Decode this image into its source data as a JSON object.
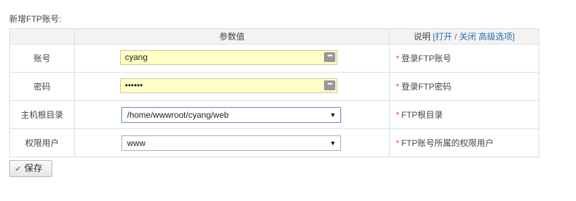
{
  "page": {
    "title": "新增FTP账号:"
  },
  "table": {
    "headers": {
      "param_value": "参数值",
      "note_prefix": "说明",
      "toggle_links": "[打开 / 关闭 高级选项]"
    }
  },
  "rows": [
    {
      "label": "账号",
      "value": "cyang",
      "note": "登录FTP账号"
    },
    {
      "label": "密码",
      "value": "••••••",
      "note": "登录FTP密码"
    },
    {
      "label": "主机根目录",
      "value": "/home/wwwroot/cyang/web",
      "note": "FTP根目录"
    },
    {
      "label": "权限用户",
      "value": "www",
      "note": "FTP账号所属的权限用户"
    }
  ],
  "required_marker": "*",
  "password_button_glyph": "•••",
  "save": {
    "label": "保存",
    "icon": "check-icon"
  },
  "colors": {
    "autofill_bg": "#ffffc6",
    "required": "#e44",
    "link": "#2a6db0"
  }
}
